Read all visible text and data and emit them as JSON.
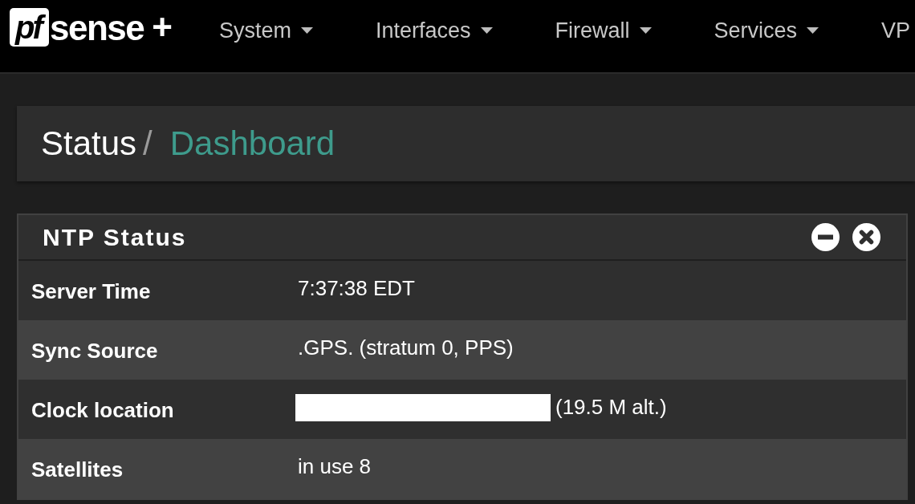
{
  "navbar": {
    "brand": {
      "tile": "pf",
      "name": "sense",
      "suffix": "+"
    },
    "menu": [
      {
        "label": "System",
        "dropdown": true
      },
      {
        "label": "Interfaces",
        "dropdown": true
      },
      {
        "label": "Firewall",
        "dropdown": true
      },
      {
        "label": "Services",
        "dropdown": true
      },
      {
        "label": "VP",
        "dropdown": false
      }
    ]
  },
  "page_header": {
    "breadcrumb": [
      {
        "label": "Status",
        "current": false
      },
      {
        "label": "Dashboard",
        "current": true
      }
    ],
    "separator": "/"
  },
  "widget": {
    "title": "NTP Status",
    "rows": [
      {
        "label": "Server Time",
        "value": "7:37:38 EDT",
        "redacted": false
      },
      {
        "label": "Sync Source",
        "value": ".GPS. (stratum 0, PPS)",
        "redacted": false
      },
      {
        "label": "Clock location",
        "value": "(19.5 M alt.)",
        "redacted": true
      },
      {
        "label": "Satellites",
        "value": "in use 8",
        "redacted": false
      }
    ]
  }
}
